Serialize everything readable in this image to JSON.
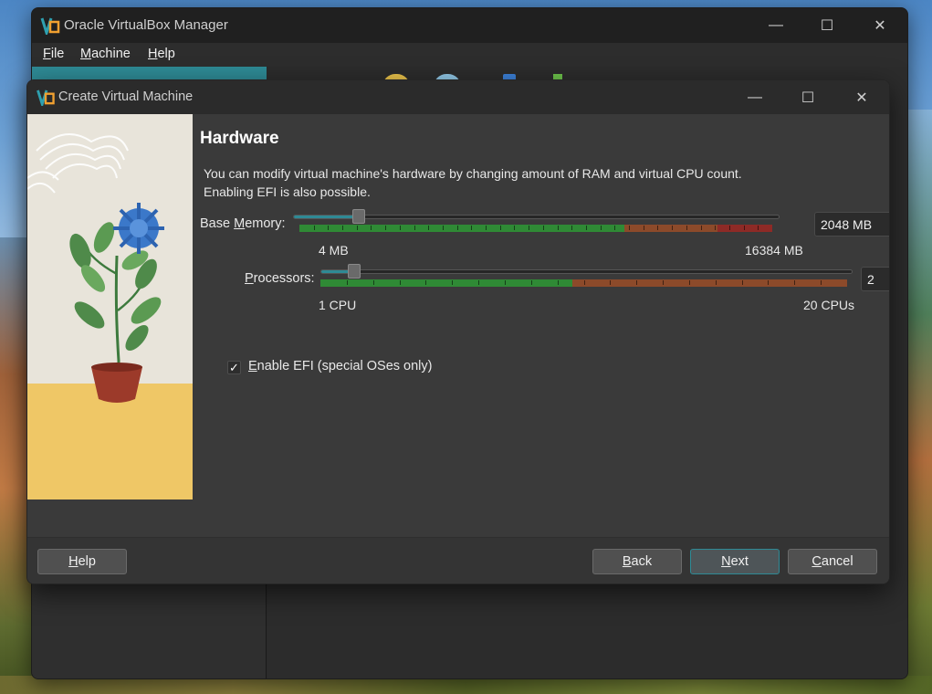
{
  "manager": {
    "title": "Oracle VirtualBox Manager",
    "menu": [
      {
        "mnemonic": "F",
        "rest": "ile"
      },
      {
        "mnemonic": "M",
        "rest": "achine"
      },
      {
        "mnemonic": "H",
        "rest": "elp"
      }
    ],
    "window_buttons": [
      "minimize-icon",
      "maximize-icon",
      "close-icon"
    ]
  },
  "dialog": {
    "title": "Create Virtual Machine",
    "heading": "Hardware",
    "description_line1": "You can modify virtual machine's hardware by changing amount of RAM and virtual CPU count.",
    "description_line2": "Enabling EFI is also possible.",
    "memory": {
      "label_pre": "Base ",
      "label_mnemonic": "M",
      "label_post": "emory:",
      "min_label": "4 MB",
      "max_label": "16384 MB",
      "value": "2048 MB",
      "min": 4,
      "max": 16384,
      "current": 2048
    },
    "processors": {
      "label_mnemonic": "P",
      "label_post": "rocessors:",
      "min_label": "1 CPU",
      "max_label": "20 CPUs",
      "value": "2",
      "min": 1,
      "max": 20,
      "current": 2
    },
    "efi": {
      "checked": true,
      "check_glyph": "✓",
      "label_mnemonic": "E",
      "label_post": "nable EFI (special OSes only)"
    },
    "buttons": {
      "help": {
        "mnemonic": "H",
        "rest": "elp"
      },
      "back": {
        "mnemonic": "B",
        "rest": "ack"
      },
      "next": {
        "mnemonic": "N",
        "rest": "ext"
      },
      "cancel": {
        "mnemonic": "C",
        "rest": "ancel"
      }
    }
  },
  "colors": {
    "accent": "#2e8a95",
    "scale_green": "#2f8a35",
    "scale_orange": "#8c4a2a",
    "scale_red": "#8e2a26"
  }
}
